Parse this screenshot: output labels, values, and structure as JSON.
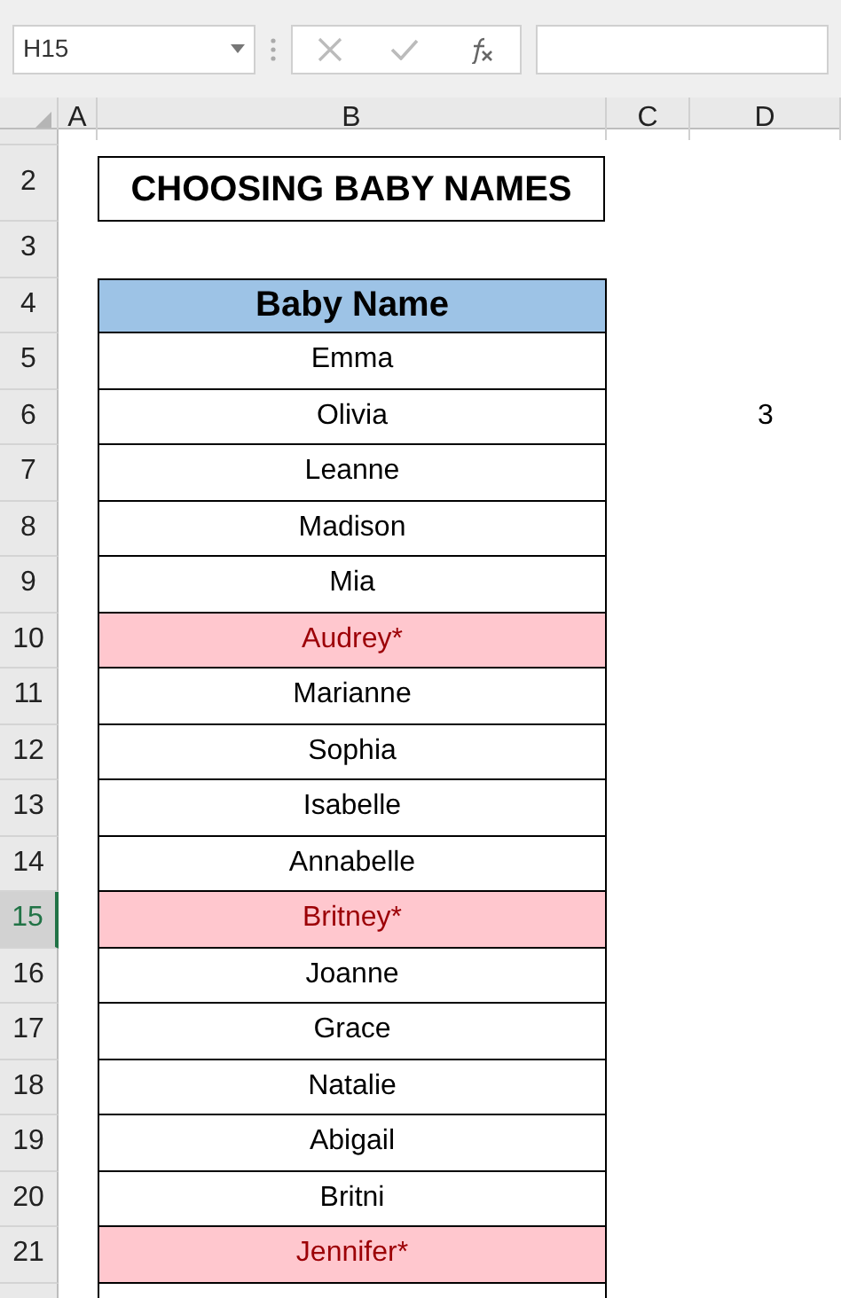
{
  "name_box": {
    "value": "H15"
  },
  "columns": [
    {
      "label": "A",
      "selected": false
    },
    {
      "label": "B",
      "selected": false
    },
    {
      "label": "C",
      "selected": false
    },
    {
      "label": "D",
      "selected": false
    }
  ],
  "title": "CHOOSING BABY NAMES",
  "table_header": "Baby Name",
  "rows": [
    {
      "number": "2",
      "selected": false,
      "kind": "title"
    },
    {
      "number": "3",
      "selected": false,
      "kind": "blank"
    },
    {
      "number": "4",
      "selected": false,
      "kind": "header"
    },
    {
      "number": "5",
      "selected": false,
      "kind": "name",
      "name": "Emma",
      "duplicate": false
    },
    {
      "number": "6",
      "selected": false,
      "kind": "name",
      "name": "Olivia",
      "duplicate": false,
      "column_d": "3"
    },
    {
      "number": "7",
      "selected": false,
      "kind": "name",
      "name": "Leanne",
      "duplicate": false
    },
    {
      "number": "8",
      "selected": false,
      "kind": "name",
      "name": "Madison",
      "duplicate": false
    },
    {
      "number": "9",
      "selected": false,
      "kind": "name",
      "name": "Mia",
      "duplicate": false
    },
    {
      "number": "10",
      "selected": false,
      "kind": "name",
      "name": "Audrey*",
      "duplicate": true
    },
    {
      "number": "11",
      "selected": false,
      "kind": "name",
      "name": "Marianne",
      "duplicate": false
    },
    {
      "number": "12",
      "selected": false,
      "kind": "name",
      "name": "Sophia",
      "duplicate": false
    },
    {
      "number": "13",
      "selected": false,
      "kind": "name",
      "name": "Isabelle",
      "duplicate": false
    },
    {
      "number": "14",
      "selected": false,
      "kind": "name",
      "name": "Annabelle",
      "duplicate": false
    },
    {
      "number": "15",
      "selected": true,
      "kind": "name",
      "name": "Britney*",
      "duplicate": true
    },
    {
      "number": "16",
      "selected": false,
      "kind": "name",
      "name": "Joanne",
      "duplicate": false
    },
    {
      "number": "17",
      "selected": false,
      "kind": "name",
      "name": "Grace",
      "duplicate": false
    },
    {
      "number": "18",
      "selected": false,
      "kind": "name",
      "name": "Natalie",
      "duplicate": false
    },
    {
      "number": "19",
      "selected": false,
      "kind": "name",
      "name": "Abigail",
      "duplicate": false
    },
    {
      "number": "20",
      "selected": false,
      "kind": "name",
      "name": "Britni",
      "duplicate": false
    },
    {
      "number": "21",
      "selected": false,
      "kind": "name",
      "name": "Jennifer*",
      "duplicate": true
    }
  ]
}
